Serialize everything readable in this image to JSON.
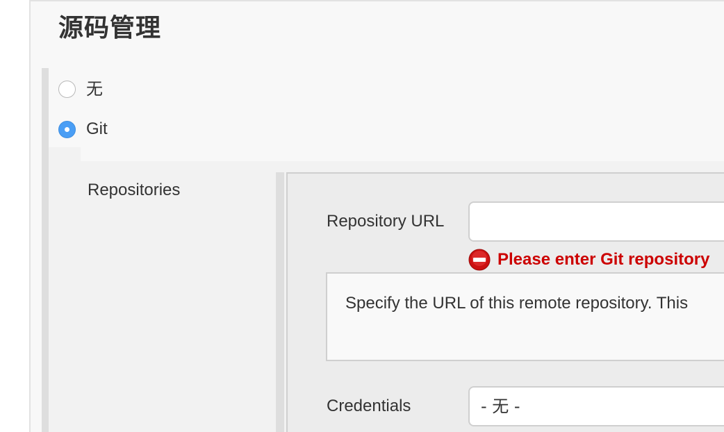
{
  "section": {
    "title": "源码管理"
  },
  "scm_options": [
    {
      "label": "无",
      "checked": false
    },
    {
      "label": "Git",
      "checked": true
    }
  ],
  "git": {
    "repositories_label": "Repositories",
    "repository_url": {
      "label": "Repository URL",
      "value": "",
      "error": "Please enter Git repository"
    },
    "help_text": "Specify the URL of this remote repository. This",
    "credentials": {
      "label": "Credentials",
      "selected": "- 无 -"
    }
  },
  "colors": {
    "accent": "#4a9ef5",
    "error": "#cc0000",
    "panel_bg": "#f8f8f8",
    "border": "#cfcfcf"
  },
  "icons": {
    "error_icon": "error-icon"
  }
}
